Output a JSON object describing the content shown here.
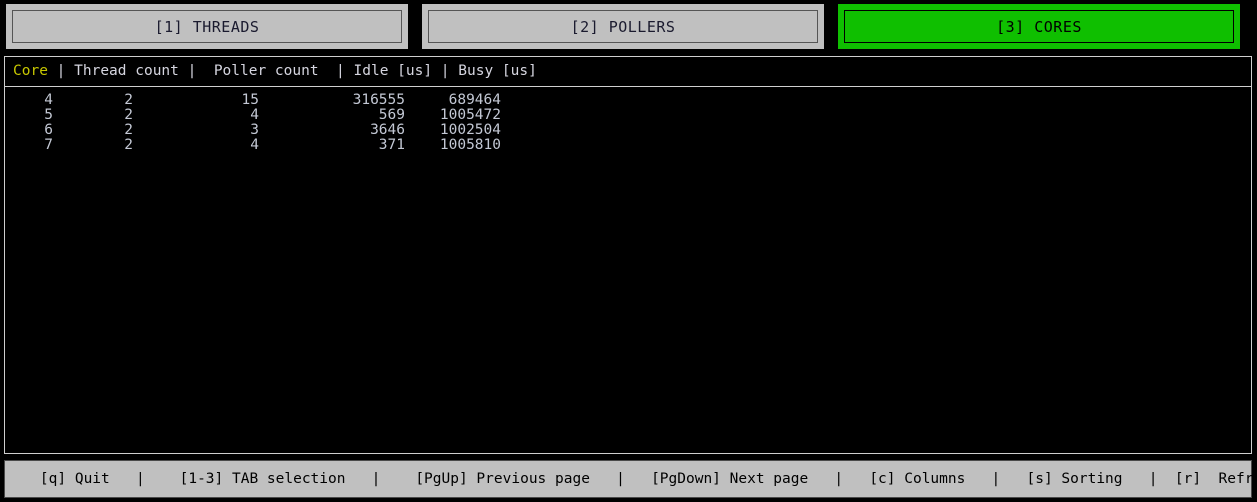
{
  "tabs": [
    {
      "label": "[1] THREADS",
      "key": "1",
      "active": false
    },
    {
      "label": "[2] POLLERS",
      "key": "2",
      "active": false
    },
    {
      "label": "[3] CORES",
      "key": "3",
      "active": true
    }
  ],
  "table": {
    "sorted_column": "Core",
    "header": {
      "core": "Core",
      "sep1": " | ",
      "thread": "Thread count",
      "sep2": " |  ",
      "poller": "Poller count",
      "sep3": "  | ",
      "idle": "Idle [us]",
      "sep4": " | ",
      "busy": "Busy [us]"
    },
    "columns": [
      "Core",
      "Thread count",
      "Poller count",
      "Idle [us]",
      "Busy [us]"
    ],
    "rows": [
      {
        "core": "4",
        "thread_count": "2",
        "poller_count": "15",
        "idle_us": "316555",
        "busy_us": "689464"
      },
      {
        "core": "5",
        "thread_count": "2",
        "poller_count": "4",
        "idle_us": "569",
        "busy_us": "1005472"
      },
      {
        "core": "6",
        "thread_count": "2",
        "poller_count": "3",
        "idle_us": "3646",
        "busy_us": "1002504"
      },
      {
        "core": "7",
        "thread_count": "2",
        "poller_count": "4",
        "idle_us": "371",
        "busy_us": "1005810"
      }
    ]
  },
  "footer": {
    "items": [
      "[q] Quit",
      "[1-3] TAB selection",
      "[PgUp] Previous page",
      "[PgDown] Next page",
      "[c] Columns",
      "[s] Sorting",
      "[r]  Refresh rate"
    ],
    "separator": "|"
  },
  "colors": {
    "background": "#000000",
    "tab_inactive_bg": "#c0c0c0",
    "tab_active_bg": "#0fbf00",
    "sorted_header": "#c8c800",
    "header_text": "#d6d6e0",
    "row_text": "#c3c8d4",
    "footer_bg": "#c0c0c0",
    "panel_border": "#cfcfcf"
  }
}
